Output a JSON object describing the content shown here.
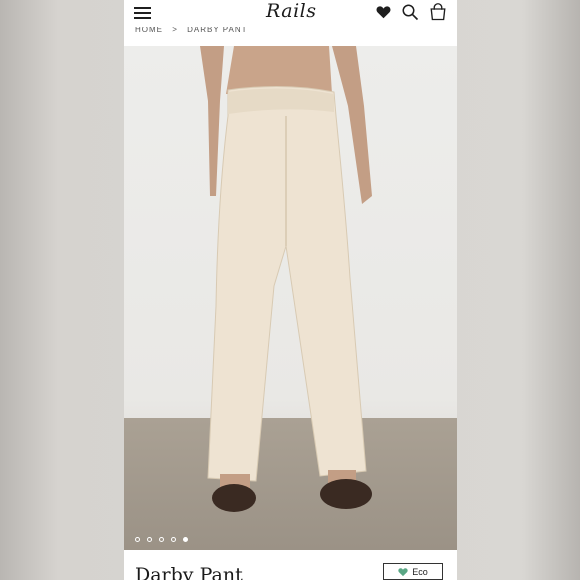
{
  "header": {
    "logo": "Rails",
    "menu_icon": "hamburger-menu-icon",
    "wishlist_icon": "heart-icon",
    "search_icon": "search-icon",
    "bag_icon": "shopping-bag-icon"
  },
  "breadcrumb": {
    "home": "HOME",
    "separator": ">",
    "current": "DARBY PANT"
  },
  "gallery": {
    "image_count": 5,
    "active_index": 5
  },
  "product": {
    "title": "Darby Pant",
    "badge_label": "Eco",
    "badge_icon": "heart-leaf-icon",
    "badge_color": "#5aa785"
  }
}
